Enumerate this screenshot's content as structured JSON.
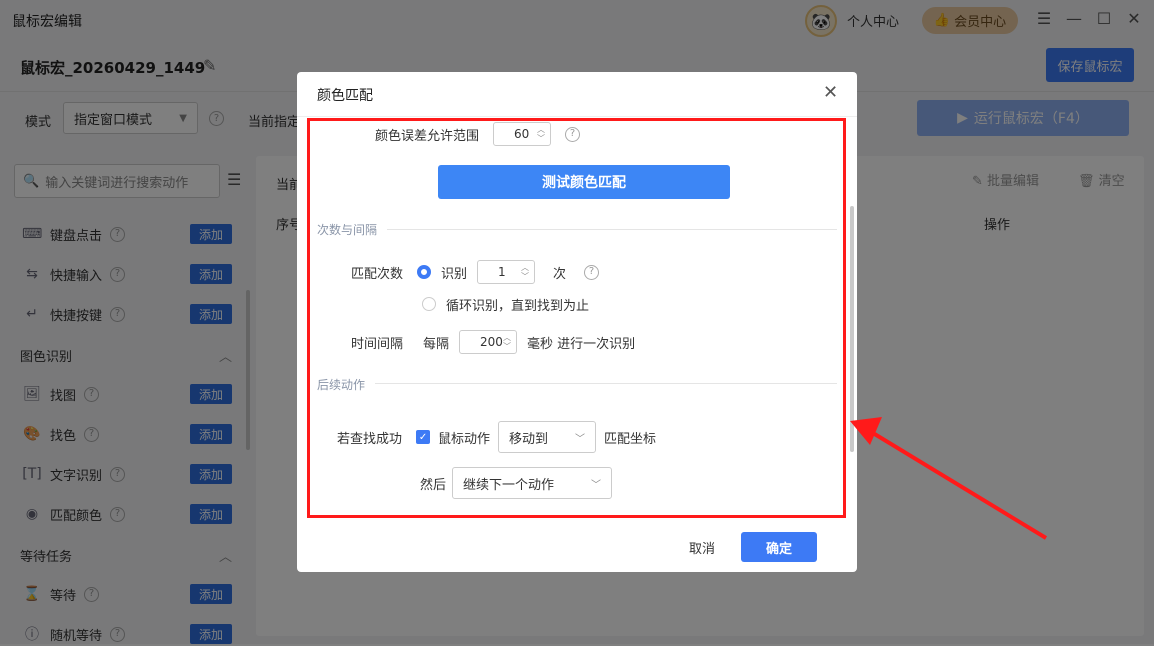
{
  "titlebar": {
    "app_title": "鼠标宏编辑",
    "personal_center": "个人中心",
    "vip_center": "会员中心"
  },
  "header": {
    "macro_name": "鼠标宏_20260429_1449",
    "save_label": "保存鼠标宏"
  },
  "toolbar": {
    "mode_label": "模式",
    "mode_value": "指定窗口模式",
    "current_label": "当前指定",
    "run_label": "运行鼠标宏（F4）"
  },
  "sidebar": {
    "search_placeholder": "输入关键词进行搜索动作",
    "add_label": "添加",
    "items_top": [
      {
        "label": "键盘点击",
        "icon": "keyboard-icon"
      },
      {
        "label": "快捷输入",
        "icon": "input-icon"
      },
      {
        "label": "快捷按键",
        "icon": "enter-key-icon"
      }
    ],
    "group_image": "图色识别",
    "items_image": [
      {
        "label": "找图",
        "icon": "image-icon"
      },
      {
        "label": "找色",
        "icon": "palette-icon"
      },
      {
        "label": "文字识别",
        "icon": "text-icon"
      },
      {
        "label": "匹配颜色",
        "icon": "color-dot-icon"
      }
    ],
    "group_wait": "等待任务",
    "items_wait": [
      {
        "label": "等待",
        "icon": "hourglass-icon"
      },
      {
        "label": "随机等待",
        "icon": "info-icon"
      }
    ]
  },
  "main": {
    "current_label": "当前",
    "batch_edit": "批量编辑",
    "clear": "清空",
    "col_seq": "序号",
    "col_op": "操作"
  },
  "dialog": {
    "title": "颜色匹配",
    "tolerance_label": "颜色误差允许范围",
    "tolerance_value": "60",
    "test_button": "测试颜色匹配",
    "section_count": "次数与间隔",
    "match_count_label": "匹配次数",
    "recognize_label": "识别",
    "recognize_value": "1",
    "times_unit": "次",
    "loop_label": "循环识别，直到找到为止",
    "interval_label": "时间间隔",
    "every_label": "每隔",
    "interval_value": "200",
    "interval_unit": "毫秒 进行一次识别",
    "section_followup": "后续动作",
    "if_found_label": "若查找成功",
    "mouse_action_label": "鼠标动作",
    "mouse_action_value": "移动到",
    "match_coord_label": "匹配坐标",
    "then_label": "然后",
    "then_value": "继续下一个动作",
    "cancel": "取消",
    "ok": "确定"
  },
  "colors": {
    "accent": "#3d7af5",
    "highlight": "#ff1a1a"
  }
}
